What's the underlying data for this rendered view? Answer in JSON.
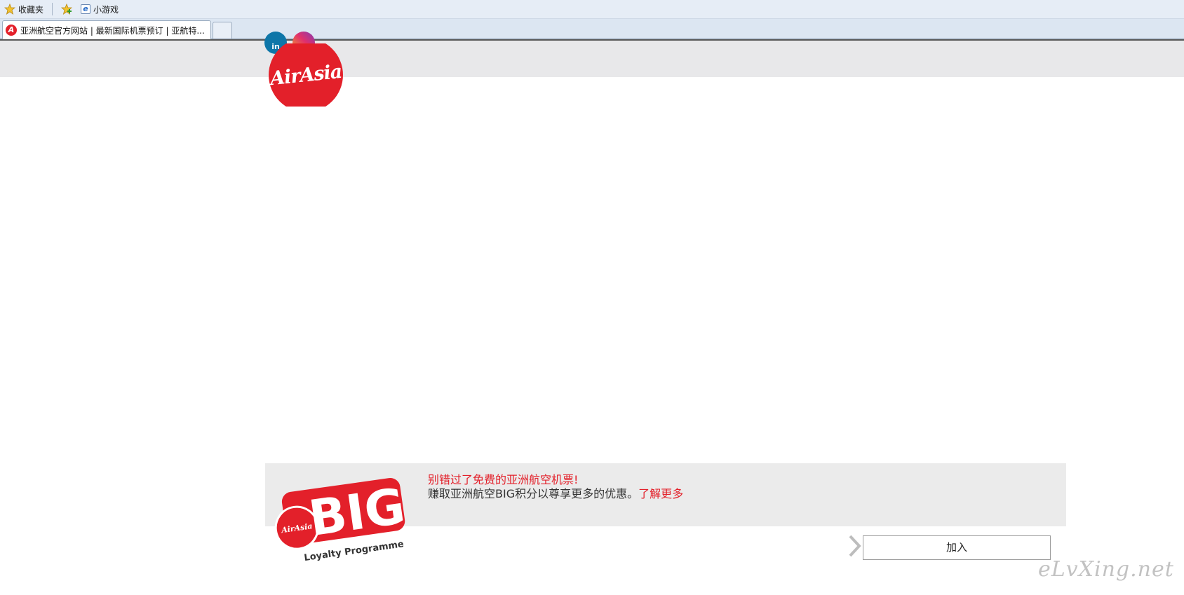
{
  "browser": {
    "favorites_label": "收藏夹",
    "games_label": "小游戏",
    "tab_title": "亚洲航空官方网站 | 最新国际机票预订 | 亚航特..."
  },
  "header": {
    "logo_text": "AirAsia"
  },
  "promo": {
    "title": "别错过了免费的亚洲航空机票!",
    "subtitle": "赚取亚洲航空BIG积分以尊享更多的优惠。",
    "link": "了解更多",
    "logo_word": "BIG",
    "logo_brand": "AirAsia",
    "logo_tagline": "Loyalty Programme",
    "join_label": "加入"
  },
  "watermark": "eLvXing.net",
  "colors": {
    "brand_red": "#e3202a",
    "header_band": "#e8e8ea",
    "promo_bg": "#ebebeb"
  }
}
